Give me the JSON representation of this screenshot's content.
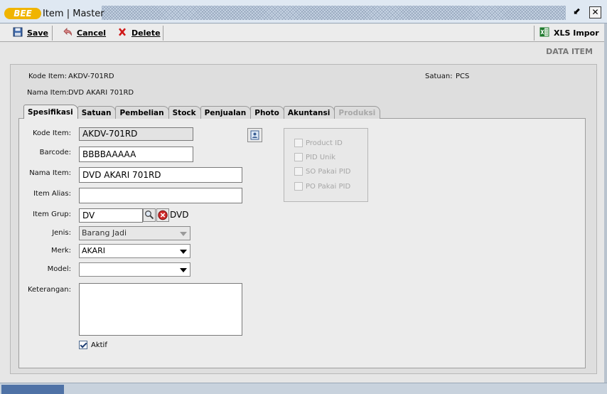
{
  "window": {
    "logo_text": "BEE",
    "title": "Item | Master",
    "restore_glyph": "⬋",
    "close_glyph": "✕"
  },
  "toolbar": {
    "save_label": "Save",
    "cancel_label": "Cancel",
    "delete_label": "Delete",
    "xls_label": "XLS Impor"
  },
  "page": {
    "section_title": "DATA ITEM"
  },
  "header": {
    "kode_item_label": "Kode Item:",
    "kode_item_value": "AKDV-701RD",
    "nama_item_label": "Nama Item:",
    "nama_item_value": "DVD AKARI 701RD",
    "satuan_label": "Satuan:",
    "satuan_value": "PCS"
  },
  "tabs": [
    {
      "label": "Spesifikasi",
      "state": "active"
    },
    {
      "label": "Satuan",
      "state": "normal"
    },
    {
      "label": "Pembelian",
      "state": "normal"
    },
    {
      "label": "Stock",
      "state": "normal"
    },
    {
      "label": "Penjualan",
      "state": "normal"
    },
    {
      "label": "Photo",
      "state": "normal"
    },
    {
      "label": "Akuntansi",
      "state": "normal"
    },
    {
      "label": "Produksi",
      "state": "disabled"
    }
  ],
  "form": {
    "kode_item": {
      "label": "Kode Item:",
      "value": "AKDV-701RD"
    },
    "barcode": {
      "label": "Barcode:",
      "value": "BBBBAAAAA"
    },
    "nama_item": {
      "label": "Nama Item:",
      "value": "DVD AKARI 701RD"
    },
    "item_alias": {
      "label": "Item Alias:",
      "value": ""
    },
    "item_grup": {
      "label": "Item Grup:",
      "value": "DV",
      "description": "DVD"
    },
    "jenis": {
      "label": "Jenis:",
      "value": "Barang Jadi"
    },
    "merk": {
      "label": "Merk:",
      "value": "AKARI"
    },
    "model": {
      "label": "Model:",
      "value": ""
    },
    "keterangan": {
      "label": "Keterangan:",
      "value": ""
    },
    "aktif": {
      "label": "Aktif",
      "checked": true
    }
  },
  "pid_options": [
    {
      "label": "Product ID",
      "checked": false
    },
    {
      "label": "PID Unik",
      "checked": false
    },
    {
      "label": "SO Pakai PID",
      "checked": false
    },
    {
      "label": "PO Pakai PID",
      "checked": false
    }
  ],
  "colors": {
    "logo": "#f0b400",
    "status_accent": "#4f72a6",
    "delete_icon": "#d01818",
    "excel_icon": "#1f7a2e"
  },
  "icons": {
    "save": "floppy-disk-icon",
    "cancel": "undo-arrow-icon",
    "delete": "red-x-icon",
    "xls": "excel-icon",
    "photo": "image-icon",
    "lookup": "magnifier-icon",
    "clear": "clear-red-icon"
  }
}
